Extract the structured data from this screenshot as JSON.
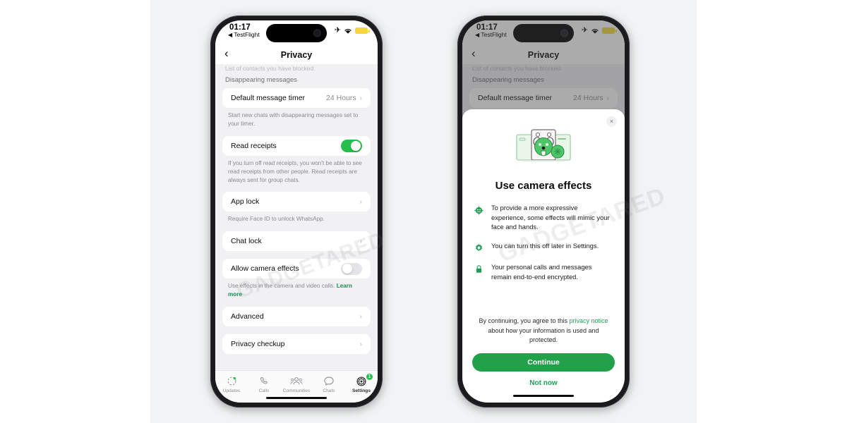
{
  "status_bar": {
    "time": "01:17",
    "back_app": "TestFlight",
    "back_arrow": "◀",
    "airplane_icon": "✈",
    "wifi_icon": "▾"
  },
  "nav": {
    "title": "Privacy",
    "back_icon": "‹"
  },
  "settings": {
    "clipped_text": "List of contacts you have blocked.",
    "group_label": "Disappearing messages",
    "timer_row": {
      "label": "Default message timer",
      "value": "24 Hours",
      "chevron": "›"
    },
    "timer_footnote": "Start new chats with disappearing messages set to your timer.",
    "read_receipts": {
      "label": "Read receipts",
      "state": "on"
    },
    "read_receipts_footnote": "If you turn off read receipts, you won't be able to see read receipts from other people. Read receipts are always sent for group chats.",
    "app_lock": {
      "label": "App lock",
      "chevron": "›"
    },
    "app_lock_footnote": "Require Face ID to unlock WhatsApp.",
    "chat_lock": {
      "label": "Chat lock",
      "chevron": "›"
    },
    "camera_effects": {
      "label": "Allow camera effects",
      "state": "off"
    },
    "camera_effects_footnote": "Use effects in the camera and video calls.",
    "camera_effects_link": "Learn more",
    "advanced": {
      "label": "Advanced",
      "chevron": "›"
    },
    "privacy_checkup": {
      "label": "Privacy checkup",
      "chevron": "›"
    }
  },
  "tabbar": {
    "items": [
      {
        "label": "Updates",
        "icon": "updates-icon",
        "active": false,
        "badge": ""
      },
      {
        "label": "Calls",
        "icon": "phone-icon",
        "active": false,
        "badge": ""
      },
      {
        "label": "Communities",
        "icon": "communities-icon",
        "active": false,
        "badge": ""
      },
      {
        "label": "Chats",
        "icon": "chat-bubble-icon",
        "active": false,
        "badge": ""
      },
      {
        "label": "Settings",
        "icon": "gear-icon",
        "active": true,
        "badge": "1"
      }
    ]
  },
  "modal": {
    "close_icon": "×",
    "title": "Use camera effects",
    "bullets": [
      {
        "icon": "face-effects-icon",
        "text": "To provide a more expressive experience, some effects will mimic your face and hands."
      },
      {
        "icon": "gear-icon",
        "text": "You can turn this off later in Settings."
      },
      {
        "icon": "lock-icon",
        "text": "Your personal calls and messages remain end-to-end encrypted."
      }
    ],
    "agree_prefix": "By continuing, you agree to this ",
    "agree_link": "privacy notice",
    "agree_suffix": " about how your information is used and protected.",
    "continue_label": "Continue",
    "not_now_label": "Not now"
  },
  "watermark": {
    "text": "GADGETARED"
  },
  "colors": {
    "accent_green": "#22a04a",
    "toggle_on": "#24c04b",
    "link_green": "#1f9d54",
    "panel_bg": "#f1f3f4",
    "page_bg": "#ffffff",
    "battery_yellow": "#f5d73d"
  }
}
